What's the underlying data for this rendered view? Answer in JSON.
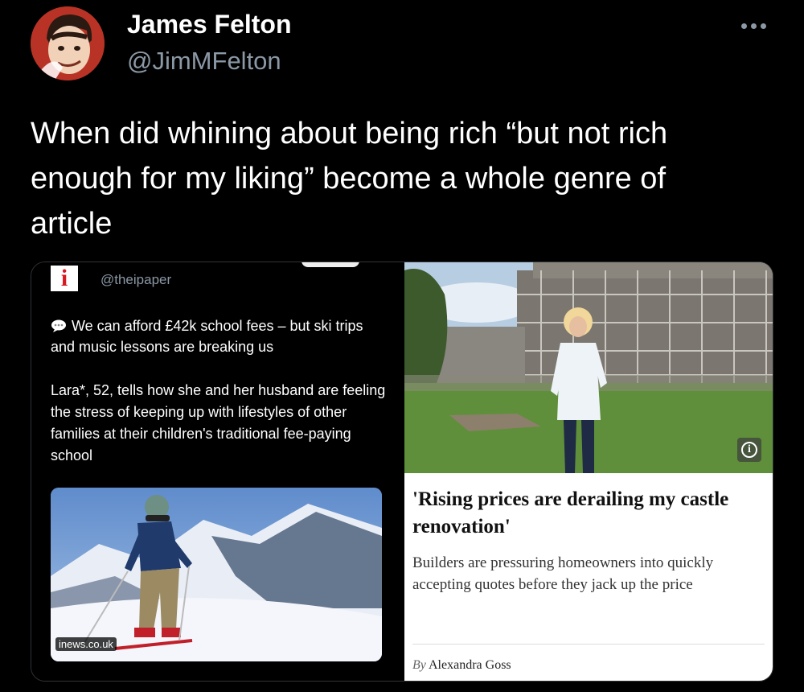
{
  "tweet": {
    "author_name": "James Felton",
    "author_handle": "@JimMFelton",
    "text": "When did whining about being rich “but not rich enough for my liking” become a whole genre of article"
  },
  "left_screenshot": {
    "logo_text": "i",
    "handle": "@theipaper",
    "headline": "We can afford £42k school fees – but ski trips and music lessons are breaking us",
    "body": "Lara*, 52, tells how she and her husband are feeling the stress of keeping up with lifestyles of other families at their children's traditional fee-paying school",
    "image_source": "inews.co.uk"
  },
  "right_article": {
    "title": "'Rising prices are derailing my castle renovation'",
    "standfirst": "Builders are pressuring homeowners into quickly accepting quotes before they jack up the price",
    "byline_prefix": "By",
    "byline_author": "Alexandra Goss"
  },
  "icons": [
    "avatar",
    "more-icon",
    "speech-bubble-icon",
    "info-icon"
  ]
}
